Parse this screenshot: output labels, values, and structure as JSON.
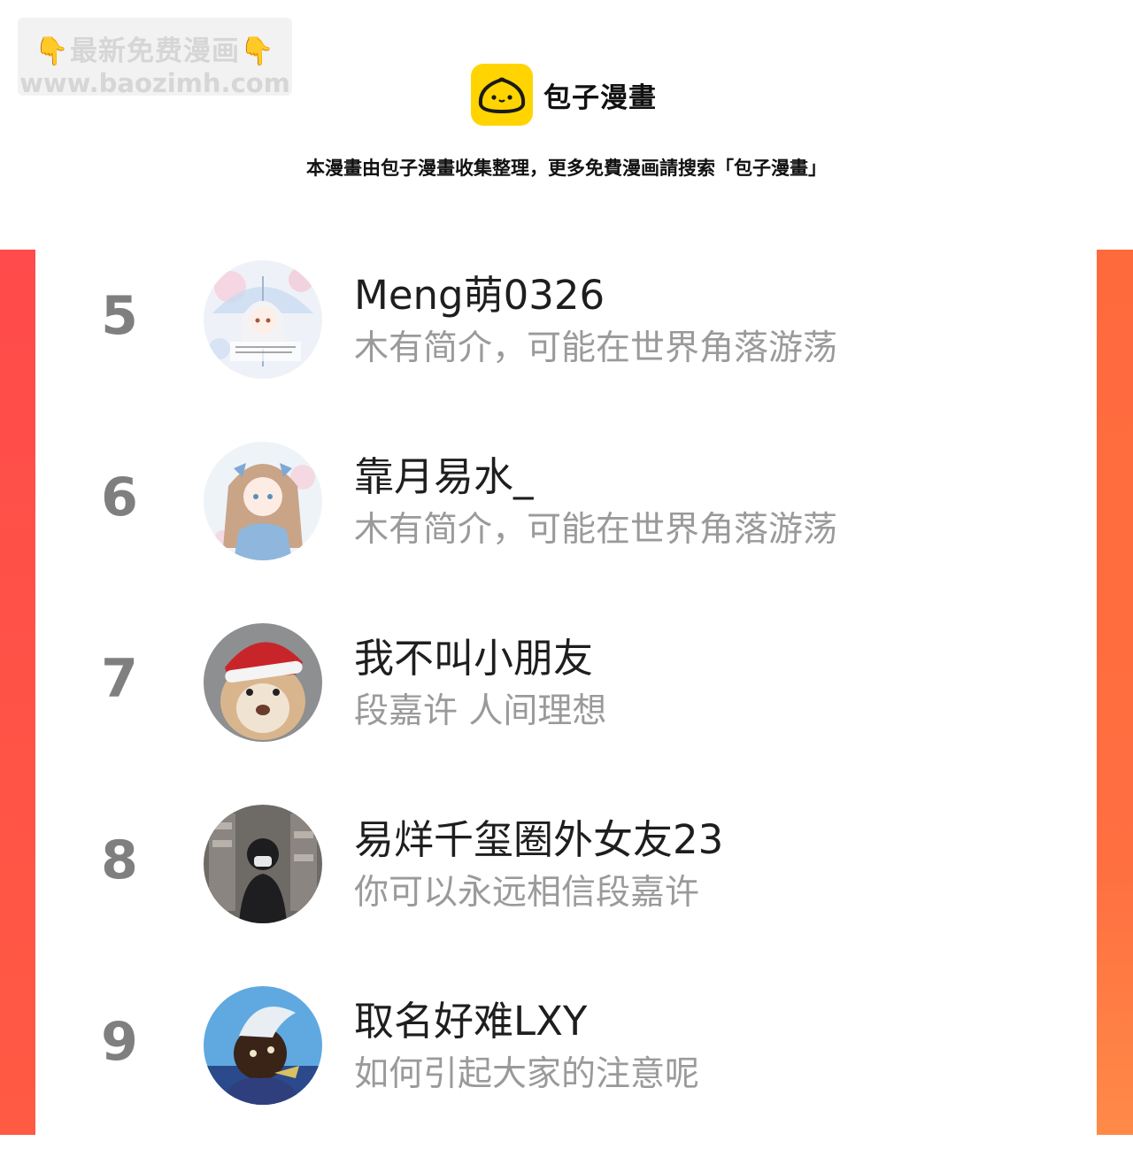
{
  "watermark": {
    "line1": "👇最新免费漫画👇",
    "line2": "www.baozimh.com"
  },
  "brand": {
    "name": "包子漫畫",
    "logo_color": "#ffd400"
  },
  "notice": "本漫畫由包子漫畫收集整理，更多免費漫画請搜索「包子漫畫」",
  "colors": {
    "bar_left": "#ff4b4b",
    "bar_right": "#ff6a3d",
    "rank_number": "#7f7f7f",
    "bio_text": "#9a9a9a"
  },
  "ranking": [
    {
      "rank": "5",
      "name": "Meng萌0326",
      "bio": "木有简介，可能在世界角落游荡",
      "avatar": "anime-girl-umbrella-avatar"
    },
    {
      "rank": "6",
      "name": "靠月易水_",
      "bio": "木有简介，可能在世界角落游荡",
      "avatar": "anime-girl-blue-dress-avatar"
    },
    {
      "rank": "7",
      "name": "我不叫小朋友",
      "bio": "段嘉许 人间理想",
      "avatar": "hamster-santa-hat-avatar"
    },
    {
      "rank": "8",
      "name": "易烊千玺圈外女友23",
      "bio": "你可以永远相信段嘉许",
      "avatar": "masked-person-photo-avatar"
    },
    {
      "rank": "9",
      "name": "取名好难LXY",
      "bio": "如何引起大家的注意呢",
      "avatar": "cartoon-character-sky-avatar"
    }
  ]
}
